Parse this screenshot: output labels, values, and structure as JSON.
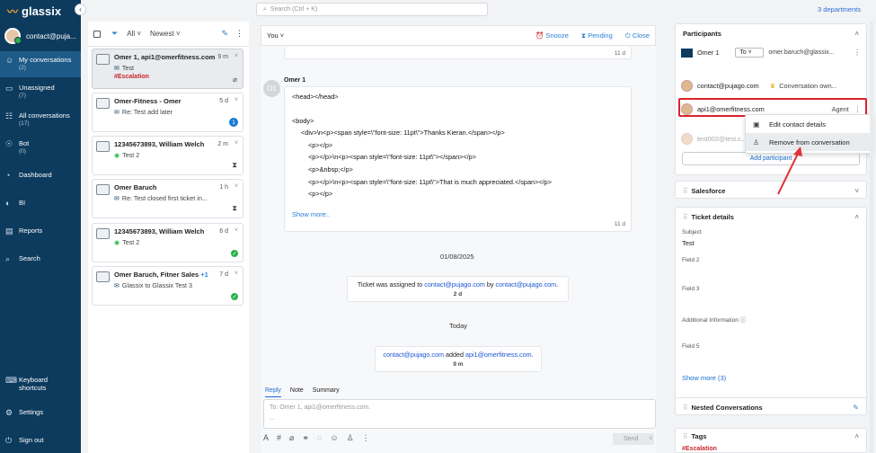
{
  "app": {
    "name": "glassix"
  },
  "user": {
    "email": "contact@puja..."
  },
  "nav": [
    {
      "label": "My conversations",
      "count": "(2)"
    },
    {
      "label": "Unassigned",
      "count": "(7)"
    },
    {
      "label": "All conversations",
      "count": "(17)"
    },
    {
      "label": "Bot",
      "count": "(0)"
    },
    {
      "label": "Dashboard",
      "count": ""
    },
    {
      "label": "BI",
      "count": ""
    },
    {
      "label": "Reports",
      "count": ""
    },
    {
      "label": "Search",
      "count": ""
    },
    {
      "label": "Keyboard shortcuts",
      "count": ""
    },
    {
      "label": "Settings",
      "count": ""
    },
    {
      "label": "Sign out",
      "count": ""
    }
  ],
  "search": {
    "placeholder": "Search (Ctrl + K)"
  },
  "departments": "3 departments",
  "list": {
    "filter_all": "All",
    "filter_sort": "Newest",
    "items": [
      {
        "name": "Omer 1, api1@omerfitness.com",
        "time": "9 m",
        "subject": "Test",
        "tag": "#Escalation"
      },
      {
        "name": "Omer-Fitness - Omer",
        "time": "5 d",
        "subject": "Re: Test add later",
        "badge": "1"
      },
      {
        "name": "12345673893, William Welch",
        "time": "2 m",
        "subject": "Test 2"
      },
      {
        "name": "Omer Baruch",
        "time": "1 h",
        "subject": "Re: Test closed first ticket in..."
      },
      {
        "name": "12345673893, William Welch",
        "time": "6 d",
        "subject": "Test 2"
      },
      {
        "name": "Omer Baruch, Fitner Sales",
        "extra": "+1",
        "time": "7 d",
        "subject": "Glassix to Glassix Test 3"
      }
    ]
  },
  "conversation": {
    "you": "You",
    "snooze": "Snooze",
    "pending": "Pending",
    "close": "Close",
    "top_time": "11 d",
    "sender_initials": "O1",
    "sender_name": "Omer 1",
    "html_lines": [
      "<head></head>",
      "<body>",
      "<div>\\n<p><span style=\\\"font-size: 11pt\\\">Thanks Kieran.</span></p>",
      "<p></p>",
      "<p></p>\\n<p><span style=\\\"font-size: 11pt\\\"></span></p>",
      "<p>&nbsp;</p>",
      "<p></p>\\n<p><span style=\\\"font-size: 11pt\\\">That is much appreciated.</span></p>",
      "<p></p>"
    ],
    "show_more": "Show more..",
    "msg_time": "11 d",
    "date": "01/08/2025",
    "sys1": {
      "pre": "Ticket was assigned to ",
      "a": "contact@pujago.com",
      "mid": " by ",
      "b": "contact@pujago.com",
      "post": ".",
      "time": "2 d"
    },
    "today": "Today",
    "sys2": {
      "a": "contact@pujago.com",
      "mid": " added ",
      "b": "api1@omerfitness.com",
      "post": ".",
      "time": "9 m"
    }
  },
  "reply": {
    "tabs": [
      "Reply",
      "Note",
      "Summary"
    ],
    "to": "To: Omer 1, api1@omerfitness.com.",
    "dots": "...",
    "send": "Send"
  },
  "participants": {
    "title": "Participants",
    "row1": {
      "name": "Omer 1",
      "to": "To",
      "email": "omer.baruch@glassix..."
    },
    "row2": {
      "email": "contact@pujago.com",
      "role": "Conversation own..."
    },
    "row3": {
      "email": "api1@omerfitness.com",
      "role": "Agent"
    },
    "row4": {
      "email": "test002@test.c..."
    },
    "add": "Add participant",
    "menu": [
      "Edit contact details",
      "Remove from conversation"
    ]
  },
  "salesforce": {
    "title": "Salesforce"
  },
  "ticket": {
    "title": "Ticket details",
    "subject_label": "Subject",
    "subject_value": "Test",
    "field2": "Field 2",
    "field3": "Field 3",
    "additional": "Additional Information",
    "field5": "Field 5",
    "show_more": "Show more (3)"
  },
  "nested": {
    "title": "Nested Conversations"
  },
  "tags": {
    "title": "Tags",
    "value": "#Escalation"
  },
  "colors": {
    "sidebar": "#0d3b5e",
    "accent": "#2a7fd4",
    "highlight": "#d8242c",
    "tag": "#c8272d"
  }
}
